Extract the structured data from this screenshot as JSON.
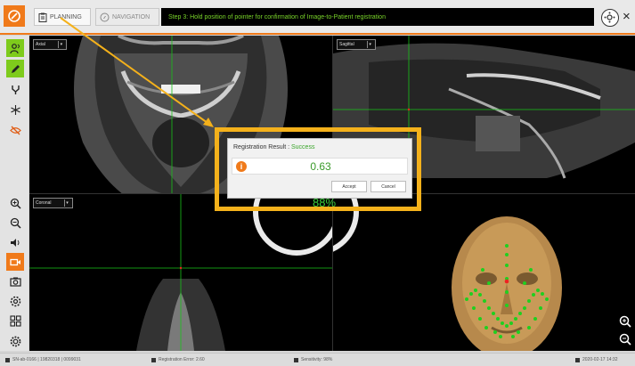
{
  "header": {
    "tabs": [
      {
        "label": "PLANNING",
        "icon": "clipboard-icon"
      },
      {
        "label": "NAVIGATION",
        "icon": "compass-icon"
      }
    ],
    "message": "Step 3: Hold position of pointer for confirmation of Image-to-Patient registration",
    "close_label": "×"
  },
  "views": {
    "axial": "Axial",
    "sagittal": "Sagittal",
    "coronal": "Coronal",
    "threed_overlay": "88%"
  },
  "dialog": {
    "title_prefix": "Registration Result :",
    "title_status": "Success",
    "value": "0.63",
    "accept_label": "Accept",
    "cancel_label": "Cancel"
  },
  "status": {
    "serial": "SN-ab-0166 | 19820318 | 0099031",
    "registration_error": "Registration Error: 2.60",
    "sensitivity": "Sensitivity: 98%",
    "datetime": "2020-02-17 14:32"
  },
  "colors": {
    "accent": "#f07a1a",
    "toolbar_active": "#7ecb1c",
    "message_text": "#7ad62a",
    "highlight_frame": "#f4b11b",
    "crosshair": "#19c419",
    "success": "#3aa52a"
  }
}
